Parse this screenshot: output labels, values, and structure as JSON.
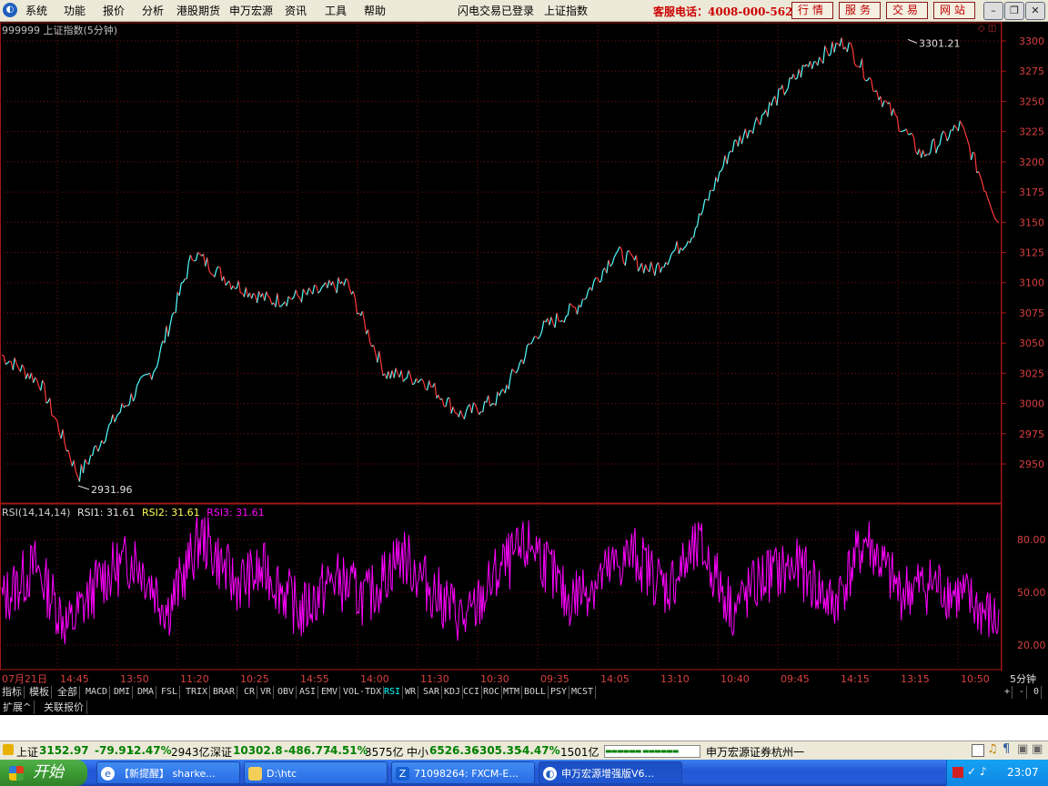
{
  "menubar": {
    "items": [
      "系统",
      "功能",
      "报价",
      "分析",
      "港股期货",
      "申万宏源",
      "资讯",
      "工具",
      "帮助"
    ],
    "login_status": "闪电交易已登录",
    "current_index": "上证指数",
    "hotline": "客服电话：4008-000-562",
    "quick_buttons": [
      "行情",
      "服务",
      "交易",
      "网站"
    ],
    "window_controls": [
      "minimize-icon",
      "restore-icon",
      "close-icon"
    ]
  },
  "chart": {
    "title": "999999 上证指数(5分钟)",
    "high_label": "3301.21",
    "low_label": "2931.96",
    "price_ticks": [
      "3300",
      "3275",
      "3250",
      "3225",
      "3200",
      "3175",
      "3150",
      "3125",
      "3100",
      "3075",
      "3050",
      "3025",
      "3000",
      "2975",
      "2950"
    ],
    "rsi_legend": {
      "name": "RSI(14,14,14)",
      "rsi1": "RSI1: 31.61",
      "rsi2": "RSI2: 31.61",
      "rsi3": "RSI3: 31.61"
    },
    "rsi_ticks": [
      "80.00",
      "50.00",
      "20.00"
    ],
    "time_labels": [
      "07月21日",
      "14:45",
      "13:50",
      "11:20",
      "10:25",
      "14:55",
      "14:00",
      "11:30",
      "10:30",
      "09:35",
      "14:05",
      "13:10",
      "10:40",
      "09:45",
      "14:15",
      "13:15",
      "10:50"
    ],
    "period": "5分钟",
    "colors": {
      "up": "#ff3a3a",
      "down": "#54ffff",
      "rsi": "#ff00ff",
      "grid": "#7a1010",
      "axis": "#a01818"
    }
  },
  "chart_data": [
    {
      "type": "line",
      "title": "999999 上证指数(5分钟)",
      "xlabel": "",
      "ylabel": "",
      "ylim": [
        2925,
        3315
      ],
      "annotations": [
        "3301.21",
        "2931.96"
      ],
      "x": [
        "07月21日",
        "14:45",
        "13:50",
        "11:20",
        "10:25",
        "14:55",
        "14:00",
        "11:30",
        "10:30",
        "09:35",
        "14:05",
        "13:10",
        "10:40",
        "09:45",
        "14:15",
        "13:15",
        "10:50"
      ],
      "series": [
        {
          "values": [
            3040,
            3018,
            2940,
            2990,
            3030,
            3125,
            3100,
            3085,
            3090,
            3100,
            3025,
            3020,
            2990,
            3005,
            3060,
            3080,
            3125,
            3110,
            3140,
            3210,
            3245,
            3280,
            3300,
            3250,
            3205,
            3230,
            3150
          ]
        }
      ]
    },
    {
      "type": "line",
      "title": "RSI(14,14,14)",
      "ylim": [
        10,
        95
      ],
      "series": [
        {
          "name": "RSI1",
          "values": [
            45,
            65,
            30,
            58,
            70,
            40,
            82,
            55,
            62,
            38,
            58,
            46,
            72,
            50,
            33,
            63,
            78,
            45,
            58,
            72,
            52,
            76,
            40,
            60,
            64,
            42,
            80,
            50,
            55,
            46,
            31.61
          ]
        }
      ]
    }
  ],
  "tabs": {
    "items": [
      "指标",
      "模板",
      "全部",
      "MACD",
      "DMI",
      "DMA",
      "FSL",
      "TRIX",
      "BRAR",
      "CR",
      "VR",
      "OBV",
      "ASI",
      "EMV",
      "VOL-TDX",
      "RSI",
      "WR",
      "SAR",
      "KDJ",
      "CCI",
      "ROC",
      "MTM",
      "BOLL",
      "PSY",
      "MCST"
    ],
    "active": "RSI",
    "right_controls": [
      "+",
      "-",
      "0"
    ]
  },
  "ext_tabs": [
    "扩展^",
    "关联报价"
  ],
  "statusbar": {
    "sh_label": "上证",
    "sh_value": "3152.97",
    "sh_change": "-79.91",
    "sh_pct": "-2.47%",
    "sh_amount": "2943亿",
    "sz_label": "深证",
    "sz_value": "10302.8",
    "sz_change": "-486.77",
    "sz_pct": "-4.51%",
    "sz_amount": "3575亿",
    "zx_label": "中小",
    "zx_value": "6526.36",
    "zx_change": "-305.35",
    "zx_pct": "-4.47%",
    "zx_amount": "1501亿",
    "broker": "申万宏源证券杭州一"
  },
  "taskbar": {
    "start": "开始",
    "items": [
      "【新提醒】 sharke...",
      "D:\\htc",
      "71098264: FXCM-E...",
      "申万宏源增强版V6..."
    ],
    "clock": "23:07"
  }
}
